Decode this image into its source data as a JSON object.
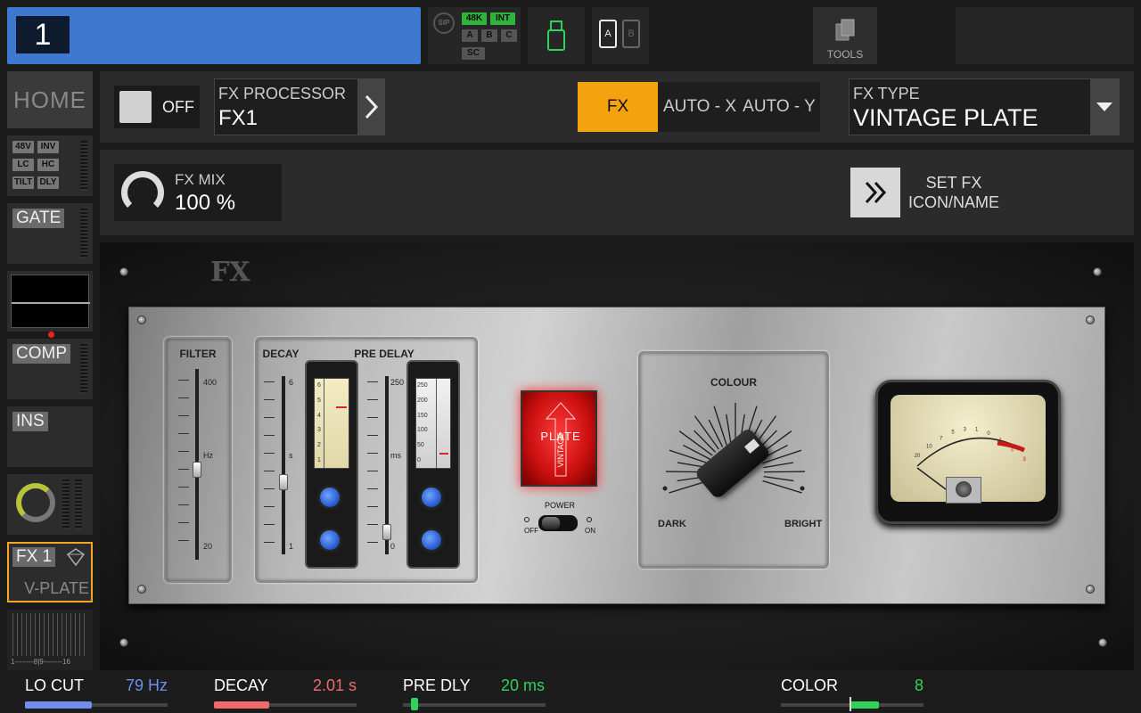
{
  "channel": {
    "number": "1",
    "color": "#3f78cf"
  },
  "status": {
    "sip": "SIP",
    "rate": "48K",
    "clock": "INT",
    "a": "A",
    "b": "B",
    "c": "C",
    "sc": "SC"
  },
  "ab_toggle": {
    "a": "A",
    "b": "B"
  },
  "tools": {
    "label": "TOOLS"
  },
  "left_strip": {
    "home": "HOME",
    "input_tags": [
      "48V",
      "INV",
      "LC",
      "HC",
      "TILT",
      "DLY"
    ],
    "gate": "GATE",
    "comp": "COMP",
    "ins": "INS",
    "fx_tag": "FX 1",
    "fx_name": "V-PLATE",
    "bus_scale": "1--------8|9--------16"
  },
  "header": {
    "power_label": "OFF",
    "fx_processor_label": "FX PROCESSOR",
    "fx_processor_value": "FX1",
    "tabs": [
      "FX",
      "AUTO - X",
      "AUTO - Y"
    ],
    "active_tab": "FX",
    "fx_type_label": "FX TYPE",
    "fx_type_value": "VINTAGE PLATE"
  },
  "mix": {
    "label": "FX MIX",
    "value": "100 %",
    "set_fx_line1": "SET FX",
    "set_fx_line2": "ICON/NAME"
  },
  "device": {
    "logo": "FX",
    "filter": {
      "label": "FILTER",
      "top": "400",
      "unit": "Hz",
      "bottom": "20"
    },
    "decay": {
      "label": "DECAY",
      "top": "6",
      "unit": "s",
      "bottom": "1",
      "gauge_scale": [
        "6",
        "5",
        "4",
        "3",
        "2",
        "1"
      ],
      "level": 0.7
    },
    "predelay": {
      "label": "PRE DELAY",
      "top": "250",
      "unit": "ms",
      "bottom": "0",
      "gauge_scale": [
        "250",
        "200",
        "150",
        "100",
        "50",
        "0"
      ],
      "level": 0.12
    },
    "plate_button": {
      "line1": "PLATE",
      "line2": "VINTAGE"
    },
    "power": {
      "label": "POWER",
      "off": "OFF",
      "on": "ON"
    },
    "colour": {
      "label": "COLOUR",
      "dark": "DARK",
      "bright": "BRIGHT"
    },
    "vu_scale": [
      "20",
      "10",
      "7",
      "5",
      "3",
      "1",
      "0",
      "1",
      "2",
      "3"
    ]
  },
  "params": [
    {
      "name": "LO CUT",
      "value": "79 Hz",
      "color": "#6f8ef0",
      "level": 0.47
    },
    {
      "name": "DECAY",
      "value": "2.01 s",
      "color": "#f06a6a",
      "level": 0.39
    },
    {
      "name": "PRE DLY",
      "value": "20 ms",
      "color": "#2fd35a",
      "level": 0.08
    },
    {
      "name": "COLOR",
      "value": "8",
      "color": "#2fd35a",
      "level": 0.5
    }
  ]
}
